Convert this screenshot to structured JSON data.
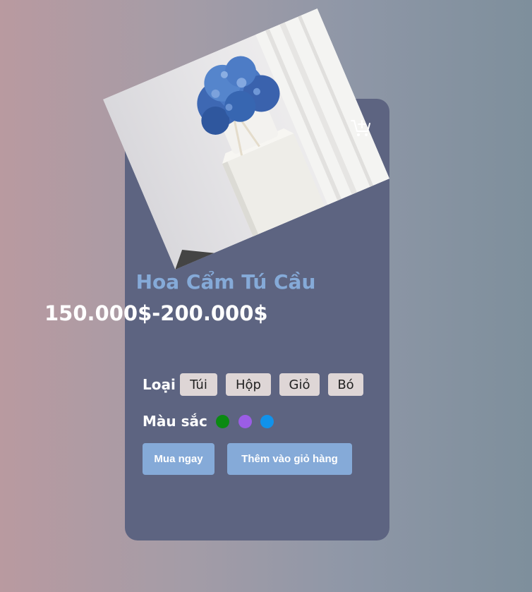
{
  "product": {
    "name": "Hoa Cẩm Tú Cầu",
    "price": "150.000$-200.000$",
    "image_icon": "hydrangea-photo"
  },
  "type_selector": {
    "label": "Loại",
    "options": [
      "Túi",
      "Hộp",
      "Giỏ",
      "Bó"
    ]
  },
  "color_selector": {
    "label": "Màu sắc",
    "swatches": [
      "#0b8a12",
      "#9b5de5",
      "#1192ea"
    ]
  },
  "actions": {
    "buy_now": "Mua ngay",
    "add_to_cart": "Thêm vào giỏ hàng"
  },
  "icons": {
    "cart": "add-to-cart-icon"
  },
  "colors": {
    "card": "#5d6481",
    "accent": "#85aad8"
  }
}
